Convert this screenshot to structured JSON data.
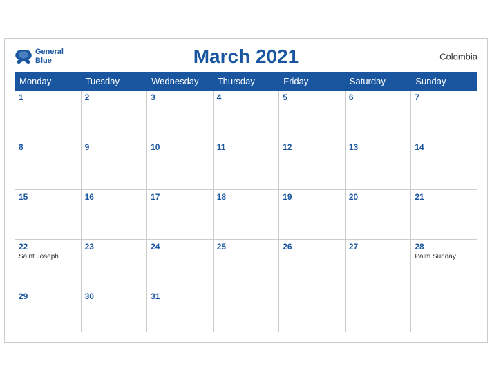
{
  "title": "March 2021",
  "country": "Colombia",
  "logo": {
    "line1": "General",
    "line2": "Blue"
  },
  "weekdays": [
    "Monday",
    "Tuesday",
    "Wednesday",
    "Thursday",
    "Friday",
    "Saturday",
    "Sunday"
  ],
  "weeks": [
    [
      {
        "day": "1",
        "event": ""
      },
      {
        "day": "2",
        "event": ""
      },
      {
        "day": "3",
        "event": ""
      },
      {
        "day": "4",
        "event": ""
      },
      {
        "day": "5",
        "event": ""
      },
      {
        "day": "6",
        "event": ""
      },
      {
        "day": "7",
        "event": ""
      }
    ],
    [
      {
        "day": "8",
        "event": ""
      },
      {
        "day": "9",
        "event": ""
      },
      {
        "day": "10",
        "event": ""
      },
      {
        "day": "11",
        "event": ""
      },
      {
        "day": "12",
        "event": ""
      },
      {
        "day": "13",
        "event": ""
      },
      {
        "day": "14",
        "event": ""
      }
    ],
    [
      {
        "day": "15",
        "event": ""
      },
      {
        "day": "16",
        "event": ""
      },
      {
        "day": "17",
        "event": ""
      },
      {
        "day": "18",
        "event": ""
      },
      {
        "day": "19",
        "event": ""
      },
      {
        "day": "20",
        "event": ""
      },
      {
        "day": "21",
        "event": ""
      }
    ],
    [
      {
        "day": "22",
        "event": "Saint Joseph"
      },
      {
        "day": "23",
        "event": ""
      },
      {
        "day": "24",
        "event": ""
      },
      {
        "day": "25",
        "event": ""
      },
      {
        "day": "26",
        "event": ""
      },
      {
        "day": "27",
        "event": ""
      },
      {
        "day": "28",
        "event": "Palm Sunday"
      }
    ],
    [
      {
        "day": "29",
        "event": ""
      },
      {
        "day": "30",
        "event": ""
      },
      {
        "day": "31",
        "event": ""
      },
      {
        "day": "",
        "event": ""
      },
      {
        "day": "",
        "event": ""
      },
      {
        "day": "",
        "event": ""
      },
      {
        "day": "",
        "event": ""
      }
    ]
  ]
}
